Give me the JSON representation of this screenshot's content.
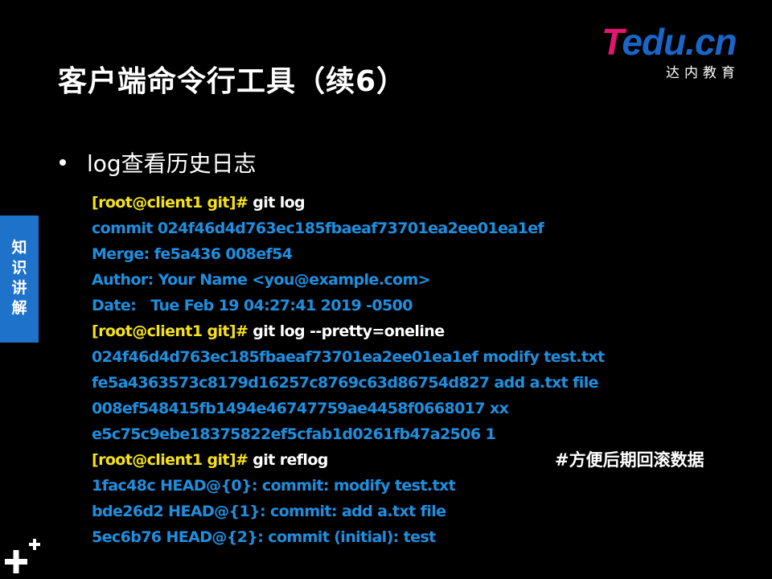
{
  "slide": {
    "title": "客户端命令行工具（续6）",
    "logo": {
      "main_t": "T",
      "main_rest": "edu.cn",
      "sub": "达内教育"
    },
    "side_tab": "知\n识\n讲\n解",
    "bullet": "log查看历史日志",
    "note": "#方便后期回滚数据",
    "lines": [
      {
        "prompt": "[root@client1 git]#",
        "cmd": " git log",
        "out": ""
      },
      {
        "prompt": "",
        "cmd": "",
        "out": "commit 024f46d4d763ec185fbaeaf73701ea2ee01ea1ef"
      },
      {
        "prompt": "",
        "cmd": "",
        "out": "Merge: fe5a436 008ef54"
      },
      {
        "prompt": "",
        "cmd": "",
        "out": "Author: Your Name <you@example.com>"
      },
      {
        "prompt": "",
        "cmd": "",
        "out": "Date:   Tue Feb 19 04:27:41 2019 -0500"
      },
      {
        "prompt": "[root@client1 git]#",
        "cmd": " git log --pretty=oneline",
        "out": ""
      },
      {
        "prompt": "",
        "cmd": "",
        "out": "024f46d4d763ec185fbaeaf73701ea2ee01ea1ef modify test.txt"
      },
      {
        "prompt": "",
        "cmd": "",
        "out": "fe5a4363573c8179d16257c8769c63d86754d827 add a.txt file"
      },
      {
        "prompt": "",
        "cmd": "",
        "out": "008ef548415fb1494e46747759ae4458f0668017 xx"
      },
      {
        "prompt": "",
        "cmd": "",
        "out": "e5c75c9ebe18375822ef5cfab1d0261fb47a2506 1"
      },
      {
        "prompt": "[root@client1 git]#",
        "cmd": " git reflog",
        "out": ""
      },
      {
        "prompt": "",
        "cmd": "",
        "out": "1fac48c HEAD@{0}: commit: modify test.txt"
      },
      {
        "prompt": "",
        "cmd": "",
        "out": "bde26d2 HEAD@{1}: commit: add a.txt file"
      },
      {
        "prompt": "",
        "cmd": "",
        "out": "5ec6b76 HEAD@{2}: commit (initial): test"
      }
    ],
    "colors": {
      "background": "#000000",
      "prompt": "#f5e21a",
      "command": "#ffffff",
      "output": "#1e8fe0",
      "side_tab": "#1f72c9",
      "logo_t": "#e3166f",
      "logo_rest": "#1a66c8"
    },
    "icons": {
      "corner": "plus-plus-icon",
      "bullet": "bullet-dot-icon"
    }
  }
}
